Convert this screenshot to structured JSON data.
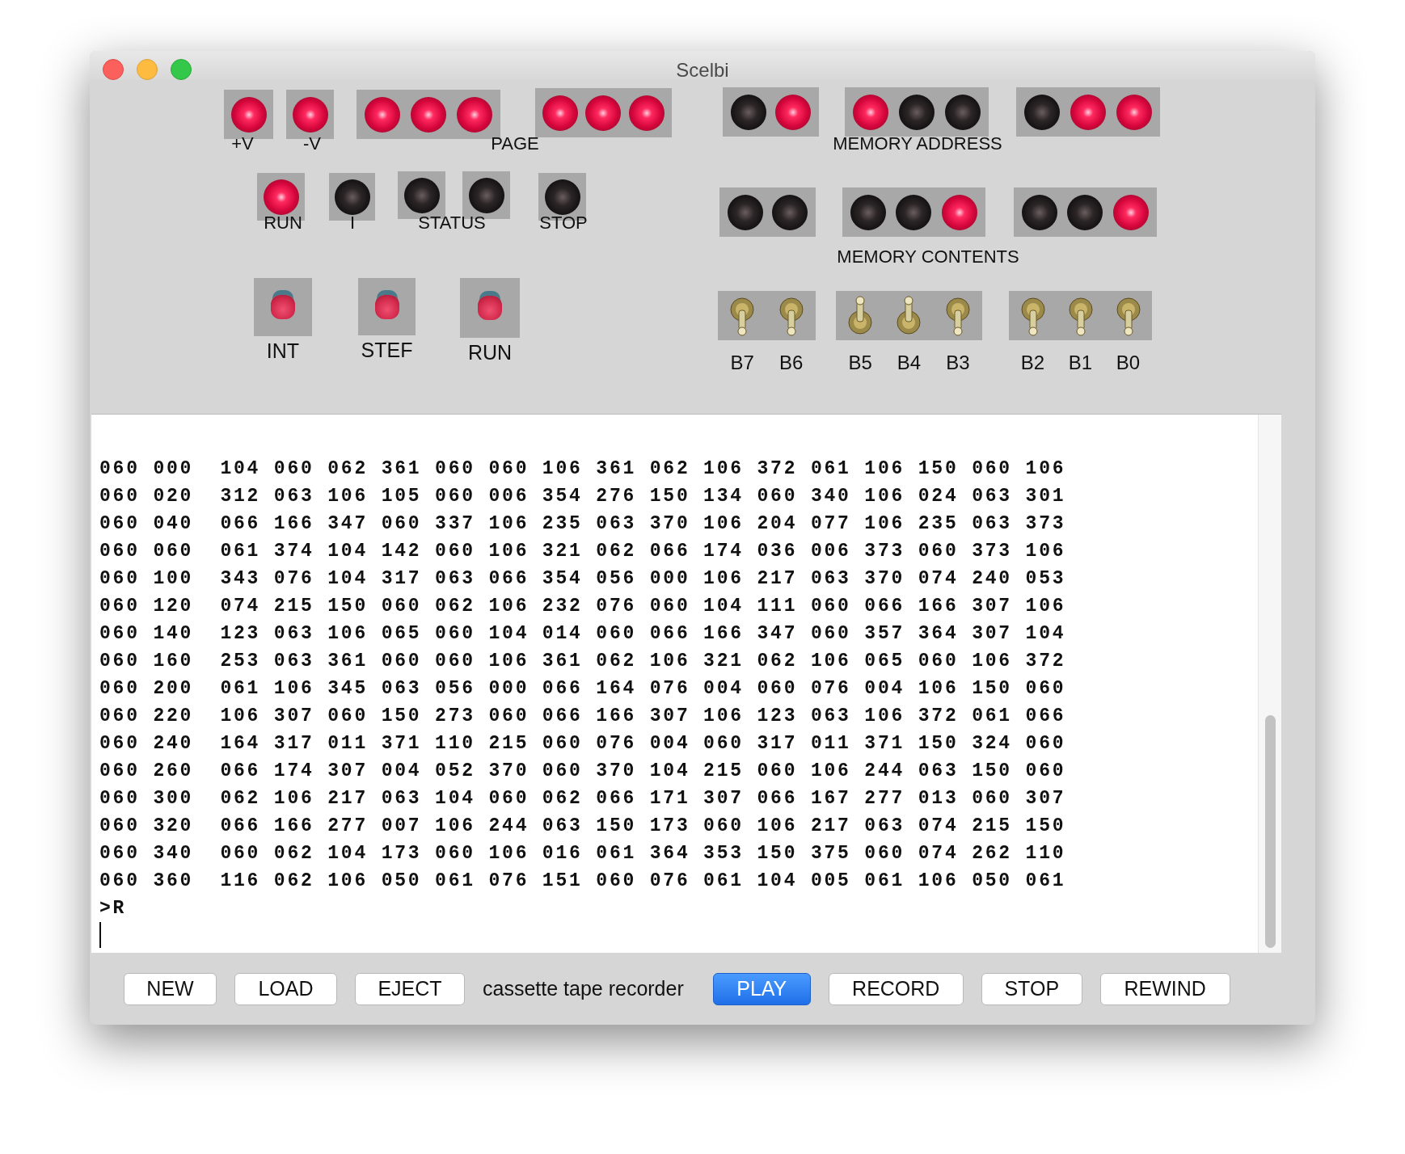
{
  "window": {
    "title": "Scelbi"
  },
  "panel": {
    "lamp_groups": [
      {
        "lamps": [
          {
            "on": true
          }
        ]
      },
      {
        "lamps": [
          {
            "on": true
          }
        ]
      },
      {
        "lamps": [
          {
            "on": true
          },
          {
            "on": true
          },
          {
            "on": true
          }
        ]
      },
      {
        "lamps": [
          {
            "on": true
          },
          {
            "on": true
          },
          {
            "on": true
          }
        ]
      },
      {
        "lamps": [
          {
            "on": false
          },
          {
            "on": true
          }
        ]
      },
      {
        "lamps": [
          {
            "on": true
          },
          {
            "on": false
          },
          {
            "on": false
          }
        ]
      },
      {
        "lamps": [
          {
            "on": false
          },
          {
            "on": true
          },
          {
            "on": true
          }
        ]
      },
      {
        "lamps": [
          {
            "on": true
          }
        ]
      },
      {
        "lamps": [
          {
            "on": false
          }
        ]
      },
      {
        "lamps": [
          {
            "on": false
          }
        ]
      },
      {
        "lamps": [
          {
            "on": false
          }
        ]
      },
      {
        "lamps": [
          {
            "on": false
          }
        ]
      },
      {
        "lamps": [
          {
            "on": false
          },
          {
            "on": false
          }
        ]
      },
      {
        "lamps": [
          {
            "on": false
          },
          {
            "on": false
          },
          {
            "on": true
          }
        ]
      },
      {
        "lamps": [
          {
            "on": false
          },
          {
            "on": false
          },
          {
            "on": true
          }
        ]
      }
    ],
    "lamp_labels": [
      "+V",
      "-V",
      "PAGE",
      "MEMORY ADDRESS",
      "RUN",
      "I",
      "STATUS",
      "STOP",
      "MEMORY CONTENTS"
    ],
    "push_buttons": [
      {
        "label": "INT"
      },
      {
        "label": "STEF"
      },
      {
        "label": "RUN"
      }
    ],
    "toggle_groups": [
      {
        "switches": [
          {
            "label": "B7",
            "up": false
          },
          {
            "label": "B6",
            "up": false
          }
        ]
      },
      {
        "switches": [
          {
            "label": "B5",
            "up": true
          },
          {
            "label": "B4",
            "up": true
          },
          {
            "label": "B3",
            "up": false
          }
        ]
      },
      {
        "switches": [
          {
            "label": "B2",
            "up": false
          },
          {
            "label": "B1",
            "up": false
          },
          {
            "label": "B0",
            "up": false
          }
        ]
      }
    ]
  },
  "terminal": {
    "lines": [
      "060 000  104 060 062 361 060 060 106 361 062 106 372 061 106 150 060 106",
      "060 020  312 063 106 105 060 006 354 276 150 134 060 340 106 024 063 301",
      "060 040  066 166 347 060 337 106 235 063 370 106 204 077 106 235 063 373",
      "060 060  061 374 104 142 060 106 321 062 066 174 036 006 373 060 373 106",
      "060 100  343 076 104 317 063 066 354 056 000 106 217 063 370 074 240 053",
      "060 120  074 215 150 060 062 106 232 076 060 104 111 060 066 166 307 106",
      "060 140  123 063 106 065 060 104 014 060 066 166 347 060 357 364 307 104",
      "060 160  253 063 361 060 060 106 361 062 106 321 062 106 065 060 106 372",
      "060 200  061 106 345 063 056 000 066 164 076 004 060 076 004 106 150 060",
      "060 220  106 307 060 150 273 060 066 166 307 106 123 063 106 372 061 066",
      "060 240  164 317 011 371 110 215 060 076 004 060 317 011 371 150 324 060",
      "060 260  066 174 307 004 052 370 060 370 104 215 060 106 244 063 150 060",
      "060 300  062 106 217 063 104 060 062 066 171 307 066 167 277 013 060 307",
      "060 320  066 166 277 007 106 244 063 150 173 060 106 217 063 074 215 150",
      "060 340  060 062 104 173 060 106 016 061 364 353 150 375 060 074 262 110",
      "060 360  116 062 106 050 061 076 151 060 076 061 104 005 061 106 050 061",
      ">R"
    ]
  },
  "toolbar": {
    "items": [
      {
        "kind": "button",
        "label": "NEW",
        "selected": false
      },
      {
        "kind": "button",
        "label": "LOAD",
        "selected": false
      },
      {
        "kind": "button",
        "label": "EJECT",
        "selected": false
      },
      {
        "kind": "text",
        "label": "cassette tape recorder"
      },
      {
        "kind": "button",
        "label": "PLAY",
        "selected": true
      },
      {
        "kind": "button",
        "label": "RECORD",
        "selected": false
      },
      {
        "kind": "button",
        "label": "STOP",
        "selected": false
      },
      {
        "kind": "button",
        "label": "REWIND",
        "selected": false
      }
    ]
  }
}
